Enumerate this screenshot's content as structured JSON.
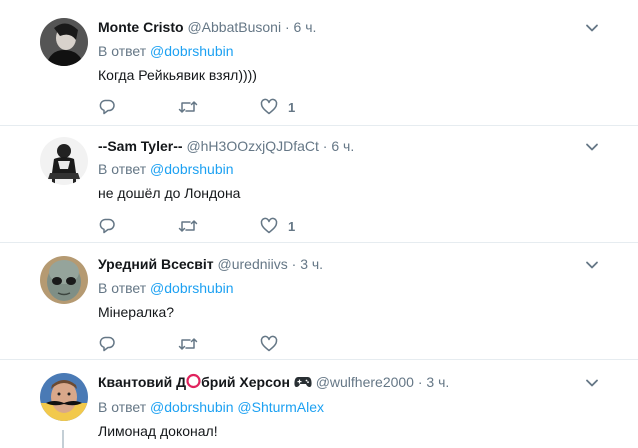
{
  "tweets": [
    {
      "name": "Monte Cristo",
      "handle": "@AbbatBusoni",
      "time": "6 ч.",
      "reply_prefix": "В ответ",
      "mentions": [
        "@dobrshubin"
      ],
      "text": "Когда Рейкьявик взял))))",
      "like_count": "1",
      "avatar_icon": "dark-figure-avatar"
    },
    {
      "name": "--Sam Tyler--",
      "handle": "@hH3OOzxjQJDfaCt",
      "time": "6 ч.",
      "reply_prefix": "В ответ",
      "mentions": [
        "@dobrshubin"
      ],
      "text": "не дошёл до Лондона",
      "like_count": "1",
      "avatar_icon": "sitting-man-avatar"
    },
    {
      "name": "Уредний Всесвіт",
      "handle": "@uredniivs",
      "time": "3 ч.",
      "reply_prefix": "В ответ",
      "mentions": [
        "@dobrshubin"
      ],
      "text": "Мінералка?",
      "like_count": "",
      "avatar_icon": "alien-avatar"
    },
    {
      "name_part1": "Квантовий Д",
      "name_part2": "брий Херсон",
      "handle": "@wulfhere2000",
      "time": "3 ч.",
      "reply_prefix": "В ответ",
      "mentions": [
        "@dobrshubin",
        "@ShturmAlex"
      ],
      "text": "Лимонад доконал!",
      "avatar_icon": "mustache-avatar"
    }
  ],
  "separator": "·",
  "colors": {
    "link": "#1da1f2",
    "secondary": "#657786",
    "text": "#14171a",
    "divider": "#e6ecf0",
    "circle_emoji": "#e0245e"
  }
}
